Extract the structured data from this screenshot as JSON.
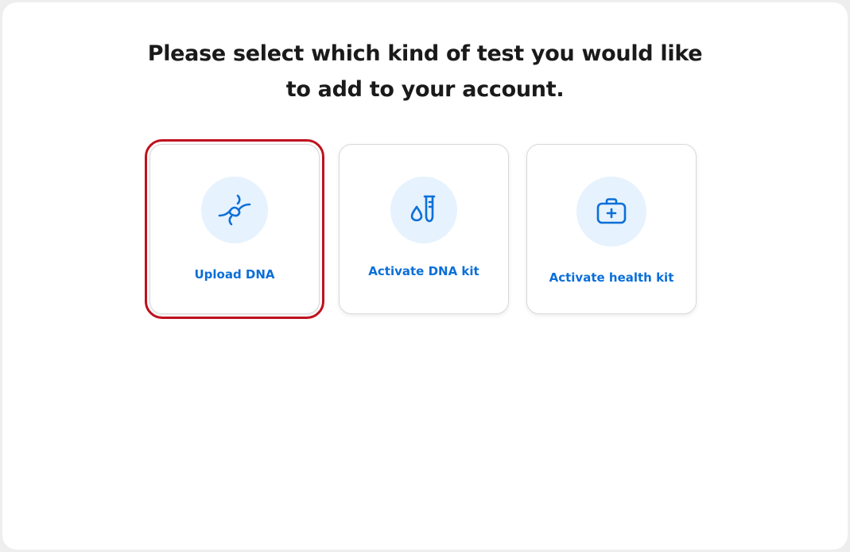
{
  "heading": {
    "line1": "Please select which kind of test you would like",
    "line2": "to add to your account."
  },
  "options": [
    {
      "label": "Upload DNA",
      "icon": "dna-helix-icon",
      "selected": true
    },
    {
      "label": "Activate DNA kit",
      "icon": "test-tube-drop-icon",
      "selected": false
    },
    {
      "label": "Activate health kit",
      "icon": "medical-kit-icon",
      "selected": false
    }
  ],
  "colors": {
    "accent": "#0b6fd8",
    "icon_bg": "#e6f2fd",
    "selected_outline": "#c0101f",
    "heading": "#1a1a1a"
  }
}
